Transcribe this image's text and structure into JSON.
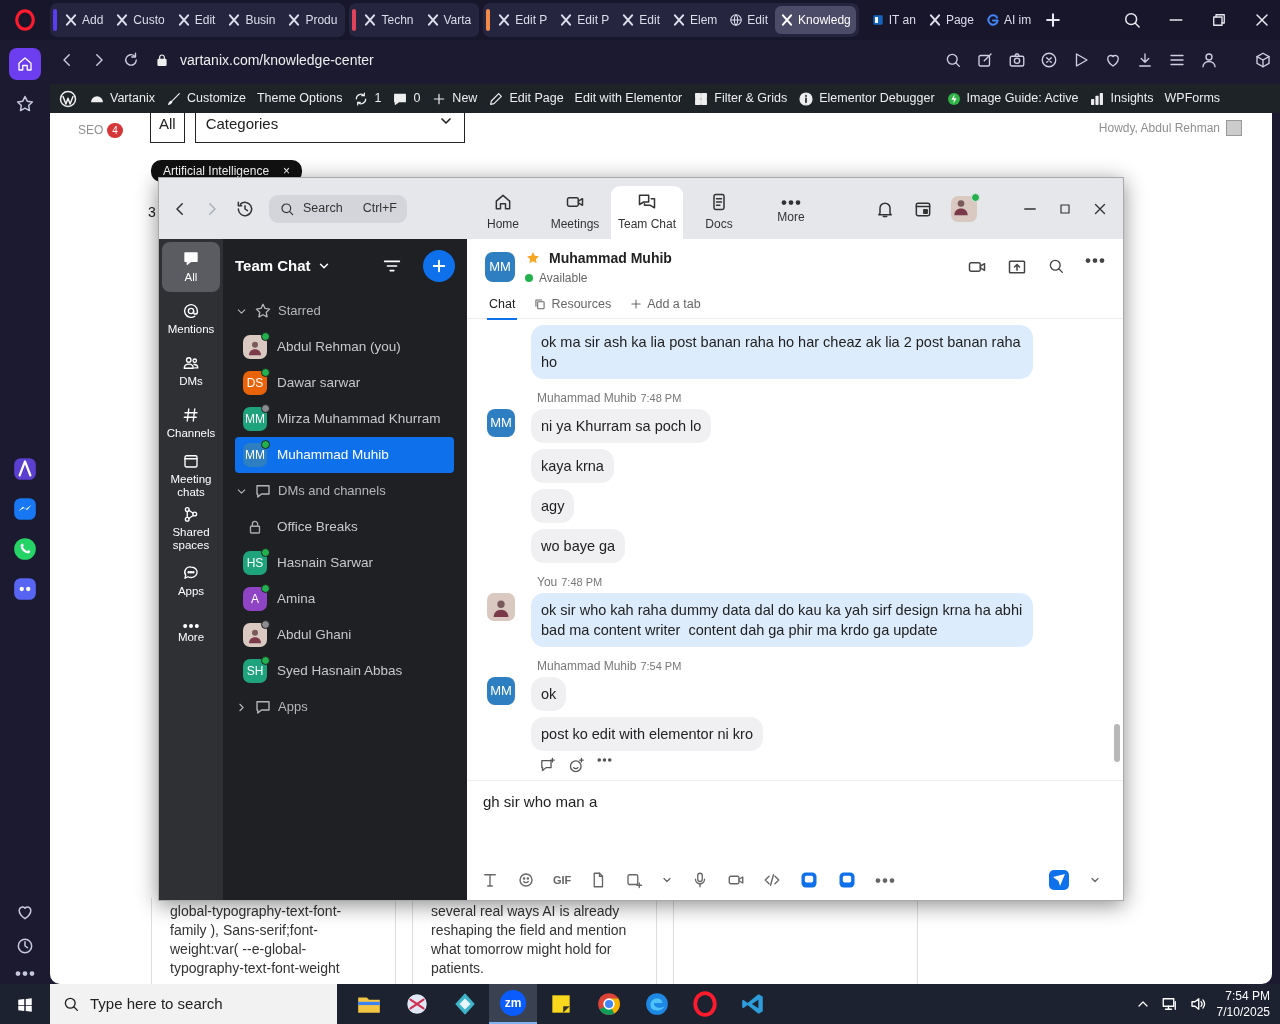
{
  "browser": {
    "tab_groups": [
      {
        "color": "#5b3df5",
        "tabs": [
          {
            "label": "Add",
            "selected": false
          },
          {
            "label": "Custo",
            "selected": false
          },
          {
            "label": "Edit",
            "selected": false
          },
          {
            "label": "Busin",
            "selected": false
          },
          {
            "label": "Produ",
            "selected": false
          }
        ]
      },
      {
        "color": "#e0435a",
        "tabs": [
          {
            "label": "Techn",
            "selected": false
          },
          {
            "label": "Varta",
            "selected": false
          }
        ]
      },
      {
        "color": "#f08a4b",
        "tabs": [
          {
            "label": "Edit P",
            "selected": false
          },
          {
            "label": "Edit P",
            "selected": false
          },
          {
            "label": "Edit",
            "selected": false
          },
          {
            "label": "Elem",
            "selected": false
          },
          {
            "label": "Edit",
            "selected": false
          },
          {
            "label": "Knowledg",
            "selected": true
          }
        ]
      },
      {
        "tabs": [
          {
            "label": "IT an",
            "selected": false
          },
          {
            "label": "Page",
            "selected": false
          },
          {
            "label": "AI im",
            "selected": false
          }
        ]
      }
    ],
    "url": "vartanix.com/knowledge-center"
  },
  "admin_bar": [
    {
      "label": "Vartanix"
    },
    {
      "label": "Customize"
    },
    {
      "label": "Theme Options"
    },
    {
      "label": "1"
    },
    {
      "label": "0"
    },
    {
      "label": "New"
    },
    {
      "label": "Edit Page"
    },
    {
      "label": "Edit with Elementor"
    },
    {
      "label": "Filter & Grids"
    },
    {
      "label": "Elementor Debugger"
    },
    {
      "label": "Image Guide: Active"
    },
    {
      "label": "Insights"
    },
    {
      "label": "WPForms"
    }
  ],
  "page": {
    "seo_label": "SEO",
    "seo_count": "4",
    "filter_all": "All",
    "category_select": "Categories",
    "howdy": "Howdy, Abdul Rehman",
    "chip": "Artificial Intelligence",
    "chip_close": "×",
    "partial_count": "3",
    "cards": [
      "global-typography-text-font-family ), Sans-serif;font-weight:var( --e-global-typography-text-font-weight",
      "several real ways AI is already reshaping the field and mention what tomorrow might hold for patients."
    ]
  },
  "zoom": {
    "search": {
      "placeholder": "Search",
      "shortcut": "Ctrl+F"
    },
    "top_tabs": [
      {
        "label": "Home",
        "selected": false
      },
      {
        "label": "Meetings",
        "selected": false
      },
      {
        "label": "Team Chat",
        "selected": true
      },
      {
        "label": "Docs",
        "selected": false
      },
      {
        "label": "More",
        "selected": false
      }
    ],
    "rail": [
      {
        "label": "All",
        "selected": true
      },
      {
        "label": "Mentions",
        "selected": false
      },
      {
        "label": "DMs",
        "selected": false
      },
      {
        "label": "Channels",
        "selected": false
      },
      {
        "label": "Meeting chats",
        "selected": false
      },
      {
        "label": "Shared spaces",
        "selected": false
      },
      {
        "label": "Apps",
        "selected": false
      },
      {
        "label": "More",
        "selected": false
      }
    ],
    "list_title": "Team Chat",
    "sections": [
      {
        "label": "Starred",
        "expanded": true,
        "items": [
          {
            "kind": "photo",
            "name": "Abdul Rehman (you)",
            "online": true,
            "selected": false
          },
          {
            "kind": "person",
            "initials": "DS",
            "color": "#e8630a",
            "name": "Dawar sarwar",
            "online": true,
            "selected": false
          },
          {
            "kind": "person",
            "initials": "MM",
            "color": "#1fa37c",
            "name": "Mirza Muhammad Khurram",
            "online": false,
            "selected": false
          },
          {
            "kind": "person",
            "initials": "MM",
            "color": "#2d7fc1",
            "name": "Muhammad Muhib",
            "online": true,
            "selected": true
          }
        ]
      },
      {
        "label": "DMs and channels",
        "expanded": true,
        "items": [
          {
            "kind": "channel",
            "name": "Office Breaks",
            "selected": false
          },
          {
            "kind": "person",
            "initials": "HS",
            "color": "#1fa37c",
            "name": "Hasnain Sarwar",
            "online": true,
            "selected": false
          },
          {
            "kind": "person",
            "initials": "A",
            "color": "#8e44c4",
            "name": "Amina",
            "online": true,
            "selected": false
          },
          {
            "kind": "photo",
            "name": "Abdul Ghani",
            "online": false,
            "selected": false
          },
          {
            "kind": "person",
            "initials": "SH",
            "color": "#1fa37c",
            "name": "Syed Hasnain Abbas",
            "online": true,
            "selected": false
          }
        ]
      },
      {
        "label": "Apps",
        "expanded": false
      }
    ],
    "chat": {
      "contact": {
        "initials": "MM",
        "color": "#2d7fc1",
        "name": "Muhammad Muhib",
        "starred": true,
        "status": "Available"
      },
      "tabs": [
        {
          "label": "Chat",
          "selected": true
        },
        {
          "label": "Resources",
          "selected": false
        },
        {
          "label": "Add a tab",
          "selected": false
        }
      ],
      "groups": [
        {
          "mine": true,
          "bubbles": [
            "ok ma sir ash ka lia post banan raha ho har cheaz ak lia 2 post banan raha ho"
          ]
        },
        {
          "mine": false,
          "sender": "Muhammad Muhib",
          "time": "7:48 PM",
          "initials": "MM",
          "bubbles": [
            "ni ya Khurram sa poch lo",
            "kaya krna",
            "agy",
            "wo baye ga"
          ]
        },
        {
          "mine": true,
          "sender": "You",
          "time": "7:48 PM",
          "bubbles": [
            "ok sir who kah raha dummy data dal do kau ka yah sirf design krna ha abhi bad ma content writer  content dah ga phir ma krdo ga update"
          ]
        },
        {
          "mine": false,
          "sender": "Muhammad Muhib",
          "time": "7:54 PM",
          "initials": "MM",
          "bubbles": [
            "ok",
            "post ko edit with elementor ni kro"
          ]
        }
      ],
      "composer": {
        "value": "gh sir who man a",
        "gif_label": "GIF"
      }
    }
  },
  "taskbar": {
    "search": {
      "placeholder": "Type here to search"
    },
    "apps": [
      {
        "selected": false
      },
      {
        "selected": false
      },
      {
        "selected": false
      },
      {
        "selected": true,
        "label": "zm"
      },
      {
        "selected": false
      },
      {
        "selected": false
      },
      {
        "selected": false
      },
      {
        "selected": false
      },
      {
        "selected": false
      }
    ],
    "time": "7:54 PM",
    "date": "7/10/2025"
  }
}
